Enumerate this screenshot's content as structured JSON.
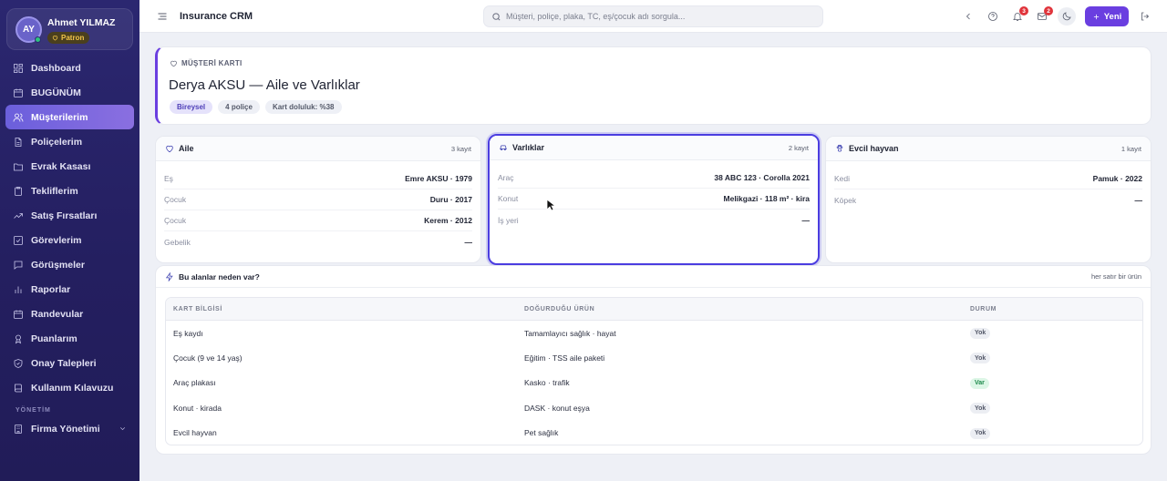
{
  "user": {
    "initials": "AY",
    "name": "Ahmet YILMAZ",
    "role": "Patron"
  },
  "sidebar": {
    "items": [
      {
        "label": "Dashboard",
        "icon": "dashboard-icon"
      },
      {
        "label": "BUGÜNÜM",
        "icon": "calendar-icon"
      },
      {
        "label": "Müşterilerim",
        "icon": "users-icon",
        "active": true
      },
      {
        "label": "Poliçelerim",
        "icon": "file-icon"
      },
      {
        "label": "Evrak Kasası",
        "icon": "folder-icon"
      },
      {
        "label": "Tekliflerim",
        "icon": "clipboard-icon"
      },
      {
        "label": "Satış Fırsatları",
        "icon": "trending-up-icon"
      },
      {
        "label": "Görevlerim",
        "icon": "check-square-icon"
      },
      {
        "label": "Görüşmeler",
        "icon": "message-icon"
      },
      {
        "label": "Raporlar",
        "icon": "bar-chart-icon"
      },
      {
        "label": "Randevular",
        "icon": "calendar-icon"
      },
      {
        "label": "Puanlarım",
        "icon": "award-icon"
      },
      {
        "label": "Onay Talepleri",
        "icon": "shield-check-icon"
      },
      {
        "label": "Kullanım Kılavuzu",
        "icon": "book-icon"
      }
    ],
    "section_label": "YÖNETİM",
    "admin_item": "Firma Yönetimi"
  },
  "topbar": {
    "title": "Insurance CRM",
    "search_placeholder": "Müşteri, poliçe, plaka, TC, eş/çocuk adı sorgula...",
    "notifications_count": "3",
    "messages_count": "2",
    "new_label": "Yeni"
  },
  "header": {
    "kicker": "MÜŞTERİ KARTI",
    "title": "Derya AKSU — Aile ve Varlıklar",
    "chips": [
      "Bireysel",
      "4 poliçe",
      "Kart doluluk: %38"
    ]
  },
  "family": {
    "title": "Aile",
    "count": "3 kayıt",
    "rows": [
      {
        "k": "Eş",
        "v": "Emre AKSU · 1979"
      },
      {
        "k": "Çocuk",
        "v": "Duru · 2017"
      },
      {
        "k": "Çocuk",
        "v": "Kerem · 2012"
      },
      {
        "k": "Gebelik",
        "v": "—"
      }
    ]
  },
  "assets": {
    "title": "Varlıklar",
    "count": "2 kayıt",
    "rows": [
      {
        "k": "Araç",
        "v": "38 ABC 123 · Corolla 2021"
      },
      {
        "k": "Konut",
        "v": "Melikgazi · 118 m² · kira"
      },
      {
        "k": "İş yeri",
        "v": "—"
      }
    ]
  },
  "pets": {
    "title": "Evcil hayvan",
    "count": "1 kayıt",
    "rows": [
      {
        "k": "Kedi",
        "v": "Pamuk · 2022"
      },
      {
        "k": "Köpek",
        "v": "—"
      }
    ]
  },
  "why": {
    "title": "Bu alanlar neden var?",
    "note": "her satır bir ürün",
    "columns": [
      "KART BİLGİSİ",
      "DOĞURDUĞU ÜRÜN",
      "DURUM"
    ],
    "rows": [
      {
        "info": "Eş kaydı",
        "product": "Tamamlayıcı sağlık · hayat",
        "status": "Yok"
      },
      {
        "info": "Çocuk (9 ve 14 yaş)",
        "product": "Eğitim · TSS aile paketi",
        "status": "Yok"
      },
      {
        "info": "Araç plakası",
        "product": "Kasko · trafik",
        "status": "Var"
      },
      {
        "info": "Konut · kirada",
        "product": "DASK · konut eşya",
        "status": "Yok"
      },
      {
        "info": "Evcil hayvan",
        "product": "Pet sağlık",
        "status": "Yok"
      }
    ]
  },
  "colors": {
    "accent": "#6a3ee0",
    "sidebar": "#2b2770",
    "focus": "#4b3de0",
    "success": "#1e8a4c"
  }
}
